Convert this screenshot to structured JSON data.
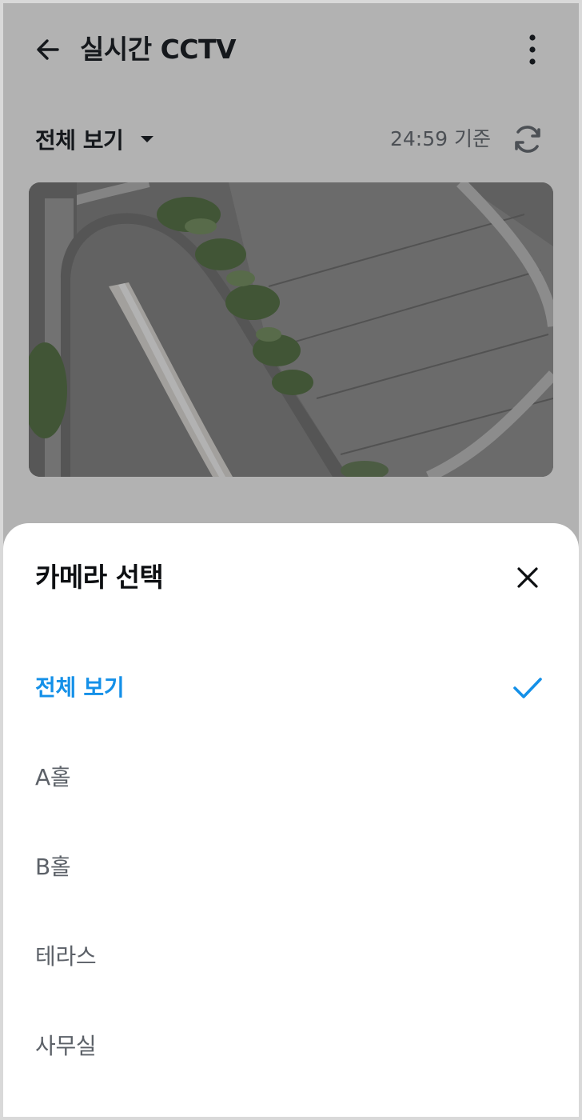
{
  "header": {
    "title": "실시간 CCTV",
    "back_icon": "arrow-left-icon",
    "more_icon": "more-vertical-icon"
  },
  "filter": {
    "selected_label": "전체 보기",
    "time_text": "24:59 기준",
    "refresh_icon": "refresh-icon"
  },
  "sheet": {
    "title": "카메라 선택",
    "close_icon": "close-icon",
    "options": [
      {
        "label": "전체 보기",
        "selected": true
      },
      {
        "label": "A홀",
        "selected": false
      },
      {
        "label": "B홀",
        "selected": false
      },
      {
        "label": "테라스",
        "selected": false
      },
      {
        "label": "사무실",
        "selected": false
      }
    ]
  },
  "colors": {
    "accent": "#1490e8",
    "title_text": "#1f2329",
    "muted_text": "#5c6168",
    "overlay": "rgba(0,0,0,0.30)"
  }
}
